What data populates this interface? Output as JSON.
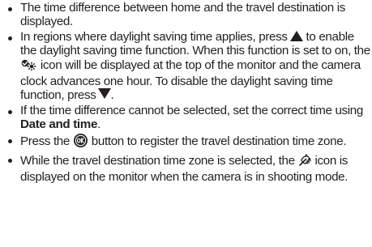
{
  "bullets": {
    "b1": {
      "text": "The time difference between home and the travel destination is displayed."
    },
    "b2": {
      "part1": "In regions where daylight saving time applies, press",
      "part2": "to enable the daylight saving time function. When this function is set to on, the",
      "part3": "icon will be displayed at the top of the monitor and the camera clock advances one hour. To disable the daylight saving time function, press",
      "part4": ".",
      "up_arrow_icon": "triangle-up",
      "dst_icon": "daylight-saving-icon",
      "down_arrow_icon": "triangle-down"
    },
    "b3": {
      "part1": "If the time difference cannot be selected, set the correct time using",
      "bold": "Date and time",
      "part2": "."
    },
    "b4": {
      "part1": "Press the",
      "part2": "button to register the travel destination time zone.",
      "ok_icon": "ok-button-icon"
    },
    "b5": {
      "part1": "While the travel destination time zone is selected, the",
      "part2": "icon is displayed on the monitor when the camera is in shooting mode.",
      "travel_icon": "travel-destination-icon"
    }
  }
}
